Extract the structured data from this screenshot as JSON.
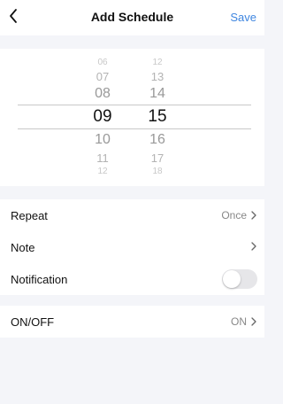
{
  "header": {
    "title": "Add Schedule",
    "save_label": "Save"
  },
  "picker": {
    "hours": [
      "06",
      "07",
      "08",
      "09",
      "10",
      "11",
      "12"
    ],
    "minutes": [
      "12",
      "13",
      "14",
      "15",
      "16",
      "17",
      "18"
    ],
    "selected_hour": "09",
    "selected_minute": "15"
  },
  "settings": {
    "repeat": {
      "label": "Repeat",
      "value": "Once"
    },
    "note": {
      "label": "Note",
      "value": ""
    },
    "notification": {
      "label": "Notification",
      "enabled": false
    }
  },
  "power": {
    "label": "ON/OFF",
    "value": "ON"
  },
  "colors": {
    "accent": "#3f86e0",
    "background": "#f4f5f9",
    "toggle_off": "#e6e6e9"
  }
}
